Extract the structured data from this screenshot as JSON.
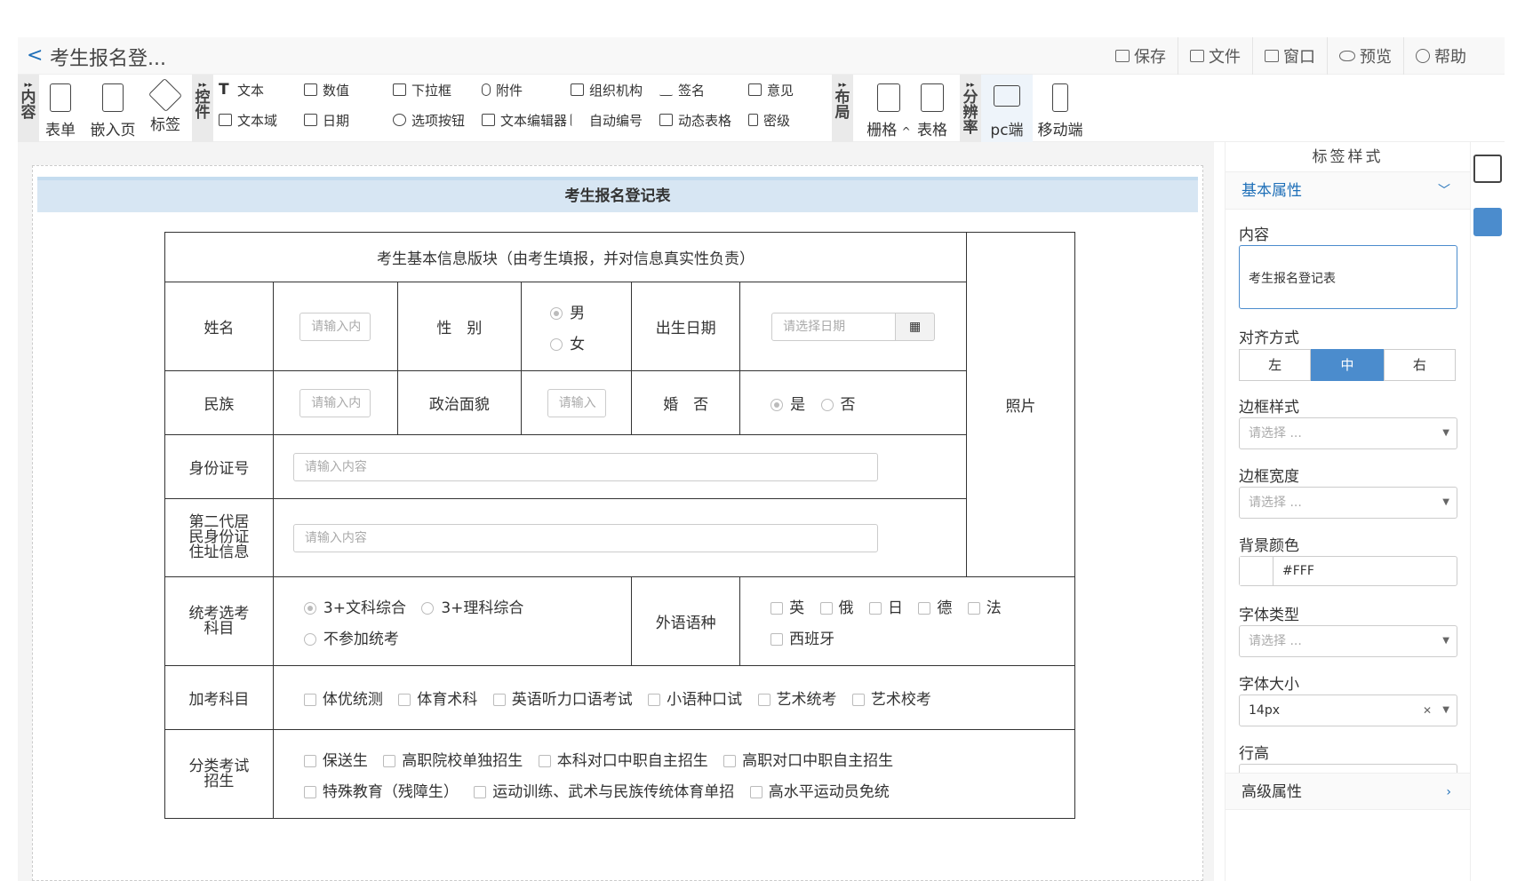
{
  "title": {
    "back": "<",
    "text": "考生报名登..."
  },
  "actions": [
    {
      "label": "保存",
      "icon": "save-icon"
    },
    {
      "label": "文件",
      "icon": "folder-icon"
    },
    {
      "label": "窗口",
      "icon": "window-icon"
    },
    {
      "label": "预览",
      "icon": "eye-icon"
    },
    {
      "label": "帮助",
      "icon": "help-icon"
    }
  ],
  "toolbar": {
    "group_content": "内容",
    "group_controls": "控件",
    "group_layout": "布局",
    "group_resolution": "分辨率",
    "content_buttons": [
      "表单",
      "嵌入页面",
      "标签"
    ],
    "controls": [
      [
        "文本",
        "文本域"
      ],
      [
        "数值",
        "日期"
      ],
      [
        "下拉框",
        "选项按钮"
      ],
      [
        "附件",
        "文本编辑器"
      ],
      [
        "组织机构",
        "自动编号"
      ],
      [
        "签名",
        "动态表格"
      ],
      [
        "意见",
        "密级"
      ]
    ],
    "layout_buttons": [
      "栅格",
      "表格"
    ],
    "grid_caret": "^",
    "resolution_buttons": [
      "pc端",
      "移动端"
    ]
  },
  "form": {
    "header": "考生报名登记表",
    "section_title": "考生基本信息版块（由考生填报，并对信息真实性负责）",
    "photo": "照片",
    "name_label": "姓名",
    "name_placeholder": "请输入内",
    "gender_label": "性　别",
    "gender_male": "男",
    "gender_female": "女",
    "birth_label": "出生日期",
    "birth_placeholder": "请选择日期",
    "ethnic_label": "民族",
    "ethnic_placeholder": "请输入内",
    "politics_label": "政治面貌",
    "politics_placeholder": "请输入",
    "marriage_label": "婚　否",
    "marriage_yes": "是",
    "marriage_no": "否",
    "id_label": "身份证号",
    "id_placeholder": "请输入内容",
    "address_label": "第二代居民身份证住址信息",
    "address_placeholder": "请输入内容",
    "exam_label": "统考选考科目",
    "exam_opts": [
      "3+文科综合",
      "3+理科综合",
      "不参加统考"
    ],
    "lang_label": "外语语种",
    "lang_opts": [
      "英",
      "俄",
      "日",
      "德",
      "法",
      "西班牙"
    ],
    "extra_label": "加考科目",
    "extra_opts": [
      "体优统测",
      "体育术科",
      "英语听力口语考试",
      "小语种口试",
      "艺术统考",
      "艺术校考"
    ],
    "class_label": "分类考试招生",
    "class_opts_1": [
      "保送生",
      "高职院校单独招生",
      "本科对口中职自主招生",
      "高职对口中职自主招生"
    ],
    "class_opts_2": [
      "特殊教育（残障生）",
      "运动训练、武术与民族传统体育单招",
      "高水平运动员免统"
    ]
  },
  "panel": {
    "title": "标签样式",
    "basic": "基本属性",
    "content_label": "内容",
    "content_value": "考生报名登记表",
    "align_label": "对齐方式",
    "align_opts": [
      "左",
      "中",
      "右"
    ],
    "align_selected": "中",
    "border_style_label": "边框样式",
    "border_width_label": "边框宽度",
    "select_placeholder": "请选择 ...",
    "bg_label": "背景颜色",
    "bg_value": "#FFF",
    "font_type_label": "字体类型",
    "font_size_label": "字体大小",
    "font_size_value": "14px",
    "line_height_label": "行高",
    "advanced": "高级属性"
  },
  "colors": {
    "accent": "#1e6fb8",
    "active": "#4b8ccd",
    "header_bg": "#d7e6f3"
  }
}
